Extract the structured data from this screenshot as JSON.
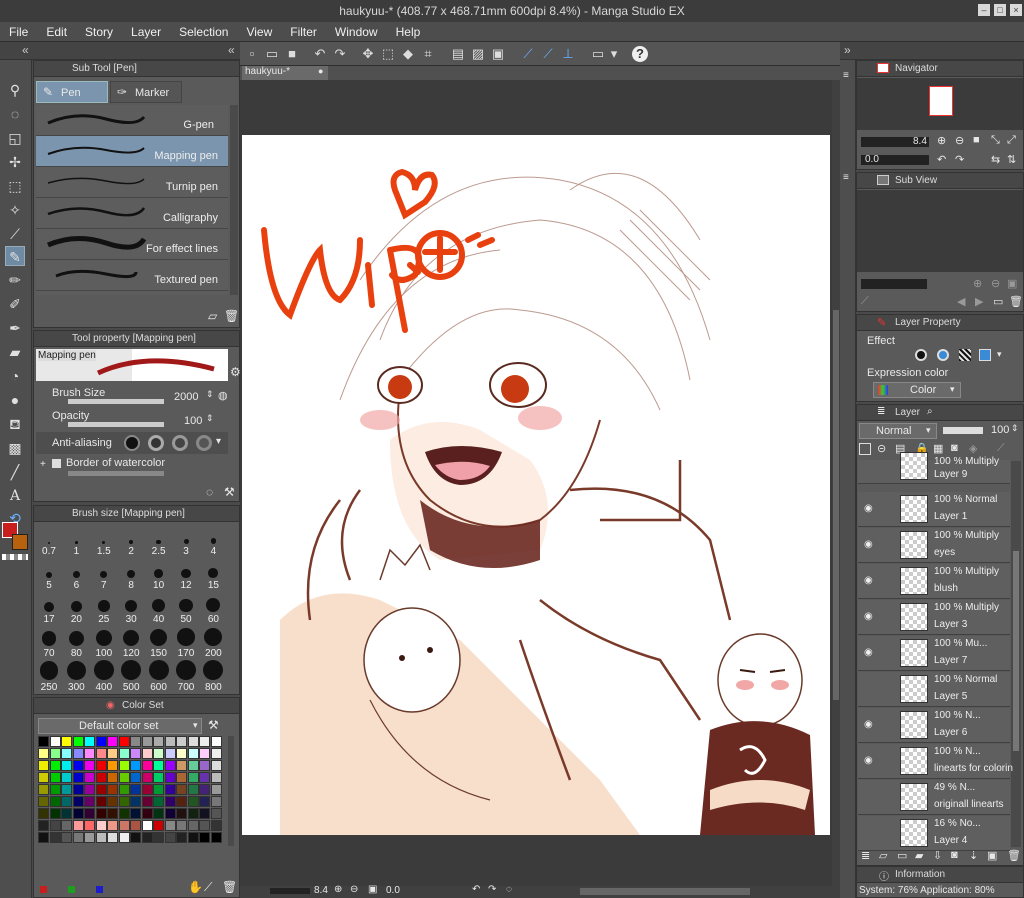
{
  "window": {
    "title": "haukyuu-* (408.77 x 468.71mm 600dpi 8.4%) - Manga Studio EX",
    "min_icon": "minimize-icon",
    "max_icon": "maximize-icon",
    "close_icon": "close-icon"
  },
  "menu": [
    "File",
    "Edit",
    "Story",
    "Layer",
    "Selection",
    "View",
    "Filter",
    "Window",
    "Help"
  ],
  "canvas_tab": "haukyuu-*",
  "sub_tool": {
    "header": "Sub Tool [Pen]",
    "tabs": [
      "Pen",
      "Marker"
    ],
    "brushes": [
      "G-pen",
      "Mapping pen",
      "Turnip pen",
      "Calligraphy",
      "For effect lines",
      "Textured pen"
    ],
    "selected": "Mapping pen"
  },
  "tool_property": {
    "header": "Tool property [Mapping pen]",
    "preview_label": "Mapping pen",
    "brush_size_label": "Brush Size",
    "brush_size_value": "2000",
    "opacity_label": "Opacity",
    "opacity_value": "100",
    "antialias_label": "Anti-aliasing",
    "watercolor_label": "Border of watercolor"
  },
  "brush_size": {
    "header": "Brush size [Mapping pen]",
    "sizes": [
      "0.7",
      "1",
      "1.5",
      "2",
      "2.5",
      "3",
      "4",
      "5",
      "6",
      "7",
      "8",
      "10",
      "12",
      "15",
      "17",
      "20",
      "25",
      "30",
      "40",
      "50",
      "60",
      "70",
      "80",
      "100",
      "120",
      "150",
      "170",
      "200",
      "250",
      "300",
      "400",
      "500",
      "600",
      "700",
      "800"
    ]
  },
  "color_set": {
    "header": "Color Set",
    "dropdown": "Default color set"
  },
  "navigator": {
    "header": "Navigator",
    "zoom": "8.4",
    "angle": "0.0"
  },
  "sub_view": {
    "header": "Sub View"
  },
  "layer_property": {
    "header": "Layer Property",
    "effect_label": "Effect",
    "expression_label": "Expression color",
    "expression_value": "Color"
  },
  "layer_panel": {
    "header": "Layer",
    "blend_mode": "Normal",
    "opacity": "100",
    "layers": [
      {
        "mode": "100 %  Multiply",
        "name": "Layer 9",
        "visible": false
      },
      {
        "mode": "100 %  Normal",
        "name": "Layer 1",
        "visible": true
      },
      {
        "mode": "100 %  Multiply",
        "name": "eyes",
        "visible": true
      },
      {
        "mode": "100 %  Multiply",
        "name": "blush",
        "visible": true
      },
      {
        "mode": "100 %  Multiply",
        "name": "Layer 3",
        "visible": true
      },
      {
        "mode": "100 %  Mu...",
        "name": "Layer 7",
        "visible": true
      },
      {
        "mode": "100 %  Normal",
        "name": "Layer 5",
        "visible": false
      },
      {
        "mode": "100 %  N...",
        "name": "Layer 6",
        "visible": true
      },
      {
        "mode": "100 %  N...",
        "name": "linearts for colorin",
        "visible": true
      },
      {
        "mode": "49 %  N...",
        "name": "originall linearts",
        "visible": false
      },
      {
        "mode": "16 %  No...",
        "name": "Layer 4",
        "visible": false
      }
    ]
  },
  "information": {
    "header": "Information",
    "status": "System: 76%   Application: 80%"
  },
  "bottom_zoom": "8.4",
  "bottom_angle": "0.0",
  "colors": {
    "main": "#c81e1e",
    "sub": "#b8620f",
    "panel": "#5a5a5a",
    "canvas_bg": "#3b3b3b",
    "art_line": "#7a3a2a",
    "wip": "#e8410f"
  }
}
